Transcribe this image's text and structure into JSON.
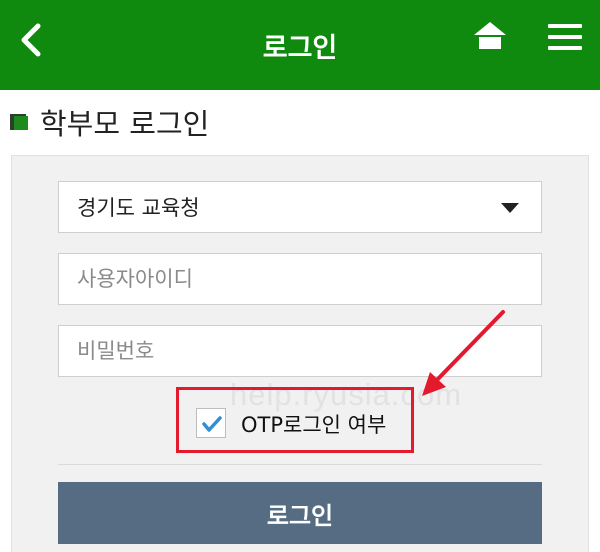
{
  "header": {
    "title": "로그인",
    "back_icon": "chevron-left-icon",
    "home_icon": "home-icon",
    "menu_icon": "hamburger-menu-icon",
    "background_color": "#0f8a0f"
  },
  "section": {
    "title": "학부모 로그인",
    "icon": "book-icon"
  },
  "form": {
    "office_select": {
      "value": "경기도 교육청"
    },
    "user_id": {
      "value": "",
      "placeholder": "사용자아이디"
    },
    "password": {
      "value": "",
      "placeholder": "비밀번호"
    },
    "otp": {
      "label": "OTP로그인 여부",
      "checked": true
    },
    "login_button": "로그인"
  },
  "watermark": "help.ryusia.com",
  "annotation": {
    "color": "#e3192d"
  },
  "colors": {
    "accent": "#0f8a0f",
    "button": "#566c83",
    "check": "#2e8fd6",
    "highlight": "#e3192d"
  }
}
